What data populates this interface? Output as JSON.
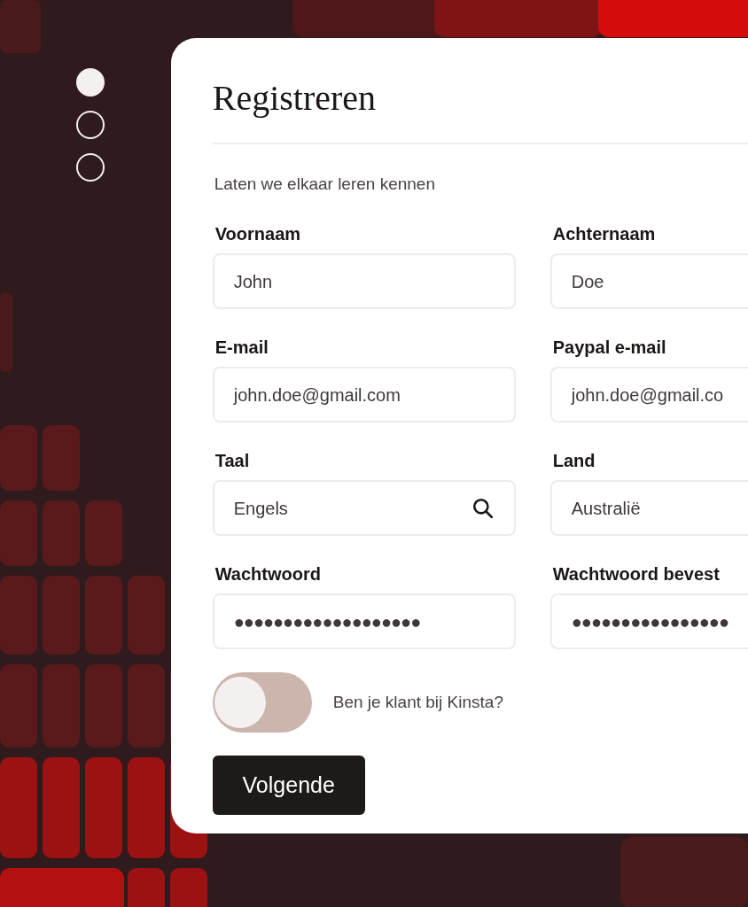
{
  "steps": [
    {
      "selected": true
    },
    {
      "selected": false
    },
    {
      "selected": false
    }
  ],
  "form": {
    "title": "Registreren",
    "subtitle": "Laten we elkaar leren kennen",
    "fields": [
      {
        "label": "Voornaam",
        "value": "John",
        "kind": "text"
      },
      {
        "label": "Achternaam",
        "value": "Doe",
        "kind": "text"
      },
      {
        "label": "E-mail",
        "value": "john.doe@gmail.com",
        "kind": "text"
      },
      {
        "label": "Paypal e-mail",
        "value": "john.doe@gmail.co",
        "kind": "text"
      },
      {
        "label": "Taal",
        "value": "Engels",
        "kind": "search"
      },
      {
        "label": "Land",
        "value": "Australië",
        "kind": "text"
      },
      {
        "label": "Wachtwoord",
        "value": "●●●●●●●●●●●●●●●●●●●",
        "kind": "password"
      },
      {
        "label": "Wachtwoord bevest",
        "value": "●●●●●●●●●●●●●●●●",
        "kind": "password"
      }
    ],
    "toggle": {
      "label": "Ben je klant bij Kinsta?",
      "on": false
    },
    "button": "Volgende"
  }
}
